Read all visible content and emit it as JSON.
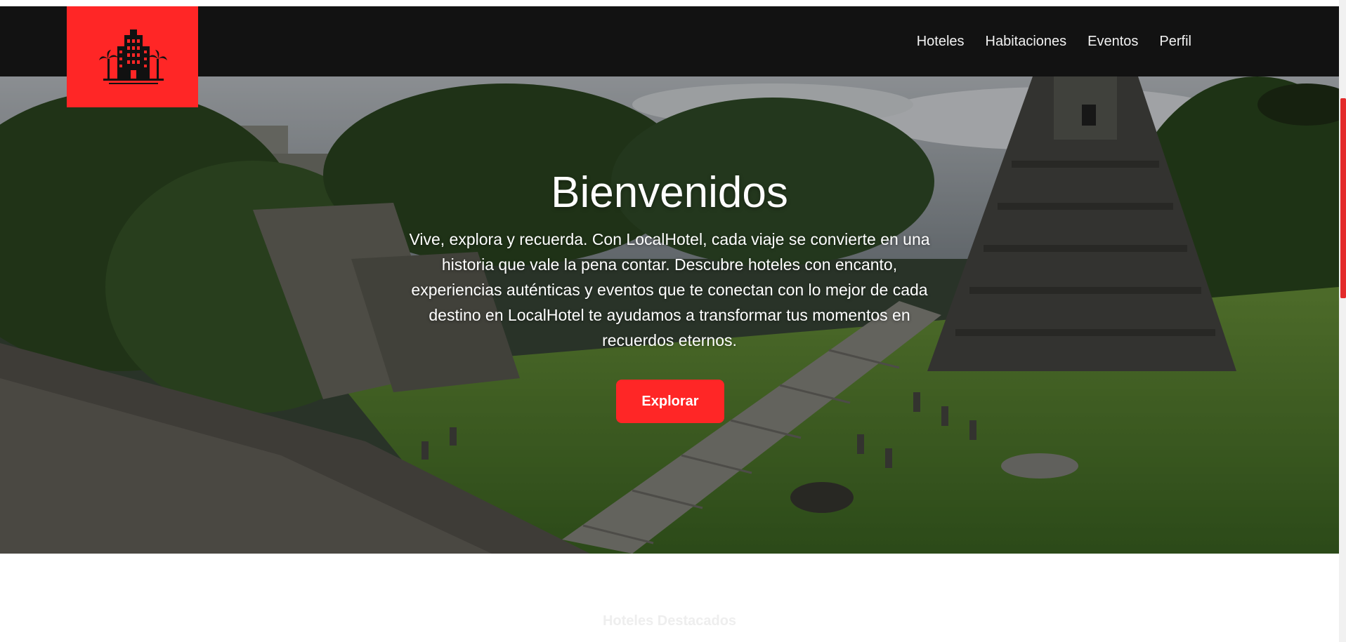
{
  "brand": {
    "logo_color": "#ff2626",
    "logo_icon": "hotel-building-with-palms-icon"
  },
  "nav": {
    "items": [
      {
        "label": "Hoteles"
      },
      {
        "label": "Habitaciones"
      },
      {
        "label": "Eventos"
      },
      {
        "label": "Perfil"
      }
    ]
  },
  "hero": {
    "title": "Bienvenidos",
    "text": "Vive, explora y recuerda. Con LocalHotel, cada viaje se convierte en una historia que vale la pena contar. Descubre hoteles con encanto, experiencias auténticas y eventos que te conectan con lo mejor de cada destino en LocalHotel te ayudamos a transformar tus momentos en recuerdos eternos.",
    "button_label": "Explorar",
    "background": "mayan-temple-ruins-jungle-photo"
  },
  "featured": {
    "heading": "Hoteles Destacados"
  },
  "colors": {
    "accent": "#ff2626",
    "navbar": "#121212"
  }
}
